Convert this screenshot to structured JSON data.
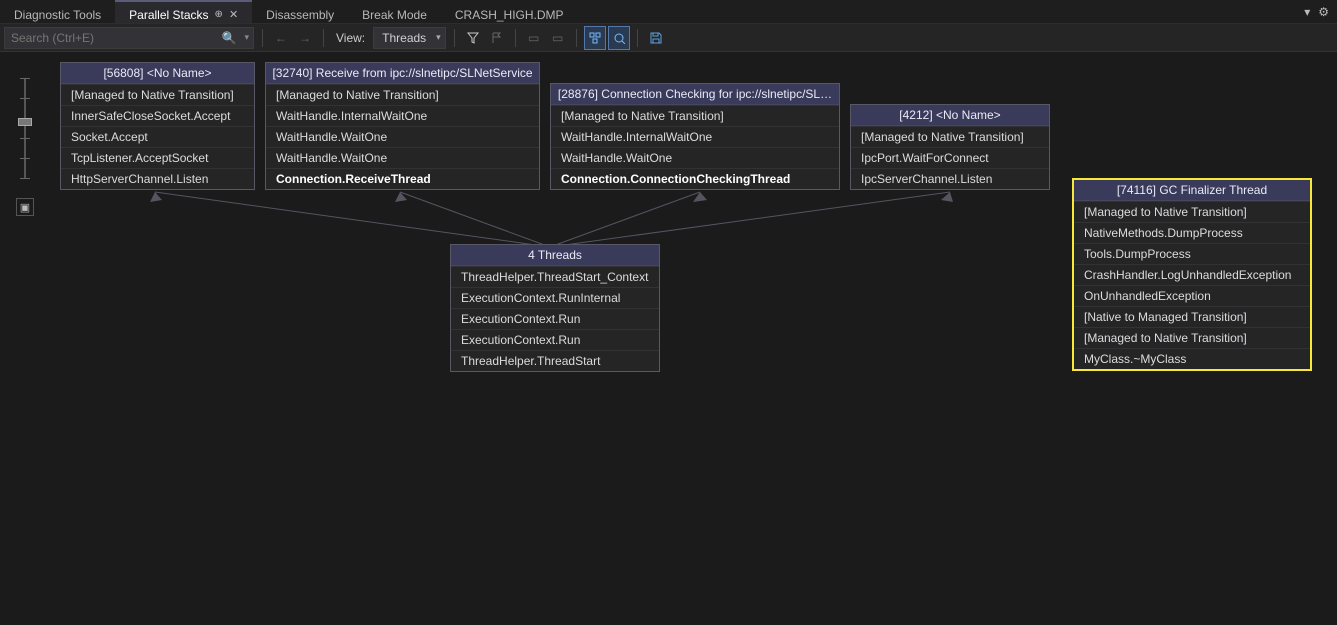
{
  "tabs": {
    "items": [
      {
        "label": "Diagnostic Tools",
        "active": false
      },
      {
        "label": "Parallel Stacks",
        "active": true,
        "pinned": true,
        "closable": true
      },
      {
        "label": "Disassembly",
        "active": false
      },
      {
        "label": "Break Mode",
        "active": false
      },
      {
        "label": "CRASH_HIGH.DMP",
        "active": false
      }
    ]
  },
  "toolbar": {
    "search_placeholder": "Search (Ctrl+E)",
    "view_label": "View:",
    "view_value": "Threads"
  },
  "boxes": {
    "b1": {
      "title": "[56808] <No Name>",
      "rows": [
        {
          "t": "[Managed to Native Transition]"
        },
        {
          "t": "InnerSafeCloseSocket.Accept"
        },
        {
          "t": "Socket.Accept"
        },
        {
          "t": "TcpListener.AcceptSocket"
        },
        {
          "t": "HttpServerChannel.Listen"
        }
      ]
    },
    "b2": {
      "title": "[32740] Receive from ipc://slnetipc/SLNetService",
      "rows": [
        {
          "t": "[Managed to Native Transition]"
        },
        {
          "t": "WaitHandle.InternalWaitOne"
        },
        {
          "t": "WaitHandle.WaitOne"
        },
        {
          "t": "WaitHandle.WaitOne"
        },
        {
          "t": "Connection.ReceiveThread",
          "b": true
        }
      ]
    },
    "b3": {
      "title": "[28876] Connection Checking for ipc://slnetipc/SL…",
      "rows": [
        {
          "t": "[Managed to Native Transition]"
        },
        {
          "t": "WaitHandle.InternalWaitOne"
        },
        {
          "t": "WaitHandle.WaitOne"
        },
        {
          "t": "Connection.ConnectionCheckingThread",
          "b": true
        }
      ]
    },
    "b4": {
      "title": "[4212] <No Name>",
      "rows": [
        {
          "t": "[Managed to Native Transition]"
        },
        {
          "t": "IpcPort.WaitForConnect"
        },
        {
          "t": "IpcServerChannel.Listen"
        }
      ]
    },
    "b5": {
      "title": "4 Threads",
      "rows": [
        {
          "t": "ThreadHelper.ThreadStart_Context"
        },
        {
          "t": "ExecutionContext.RunInternal"
        },
        {
          "t": "ExecutionContext.Run"
        },
        {
          "t": "ExecutionContext.Run"
        },
        {
          "t": "ThreadHelper.ThreadStart"
        }
      ]
    },
    "b6": {
      "title": "[74116] GC Finalizer Thread",
      "rows": [
        {
          "t": "[Managed to Native Transition]"
        },
        {
          "t": "NativeMethods.DumpProcess"
        },
        {
          "t": "Tools.DumpProcess"
        },
        {
          "t": "CrashHandler.LogUnhandledException"
        },
        {
          "t": "OnUnhandledException"
        },
        {
          "t": "[Native to Managed Transition]"
        },
        {
          "t": "[Managed to Native Transition]"
        },
        {
          "t": "MyClass.~MyClass"
        }
      ]
    }
  }
}
